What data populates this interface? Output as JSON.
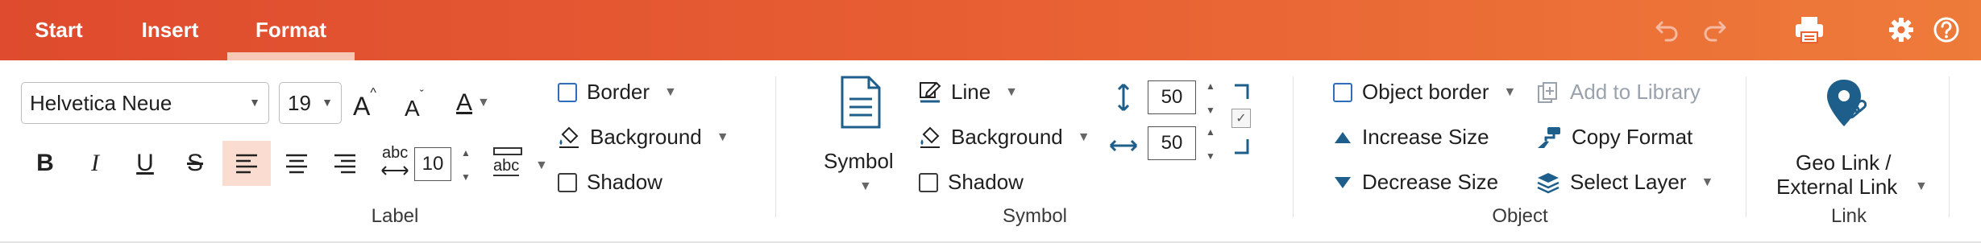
{
  "tabs": [
    {
      "label": "Start"
    },
    {
      "label": "Insert"
    },
    {
      "label": "Format"
    }
  ],
  "toolbar_icons": [
    "undo-icon",
    "redo-icon",
    "print-icon",
    "gear-icon",
    "help-icon"
  ],
  "label_group": {
    "font_family": "Helvetica Neue",
    "font_size": "19",
    "grow_font_glyph": "A",
    "shrink_font_glyph": "A",
    "font_color_glyph": "A",
    "bold": "B",
    "italic": "I",
    "underline": "U",
    "strikethrough": "S",
    "char_spacing_glyph": "abc",
    "char_spacing_value": "10",
    "text_box_glyph": "abc",
    "border": "Border",
    "background": "Background",
    "shadow": "Shadow",
    "group_title": "Label"
  },
  "symbol_group": {
    "symbol": "Symbol",
    "line": "Line",
    "background": "Background",
    "shadow": "Shadow",
    "height_value": "50",
    "width_value": "50",
    "group_title": "Symbol"
  },
  "object_group": {
    "object_border": "Object border",
    "increase_size": "Increase Size",
    "decrease_size": "Decrease Size",
    "add_to_library": "Add to Library",
    "copy_format": "Copy Format",
    "select_layer": "Select Layer",
    "group_title": "Object"
  },
  "link_group": {
    "geo_link_line1": "Geo Link /",
    "geo_link_line2": "External Link",
    "group_title": "Link"
  },
  "colors": {
    "accent_start": "#de4b2e",
    "accent_end": "#ee7b3a",
    "blue": "#1d5f8a",
    "active_bg": "#fbdcd0"
  }
}
